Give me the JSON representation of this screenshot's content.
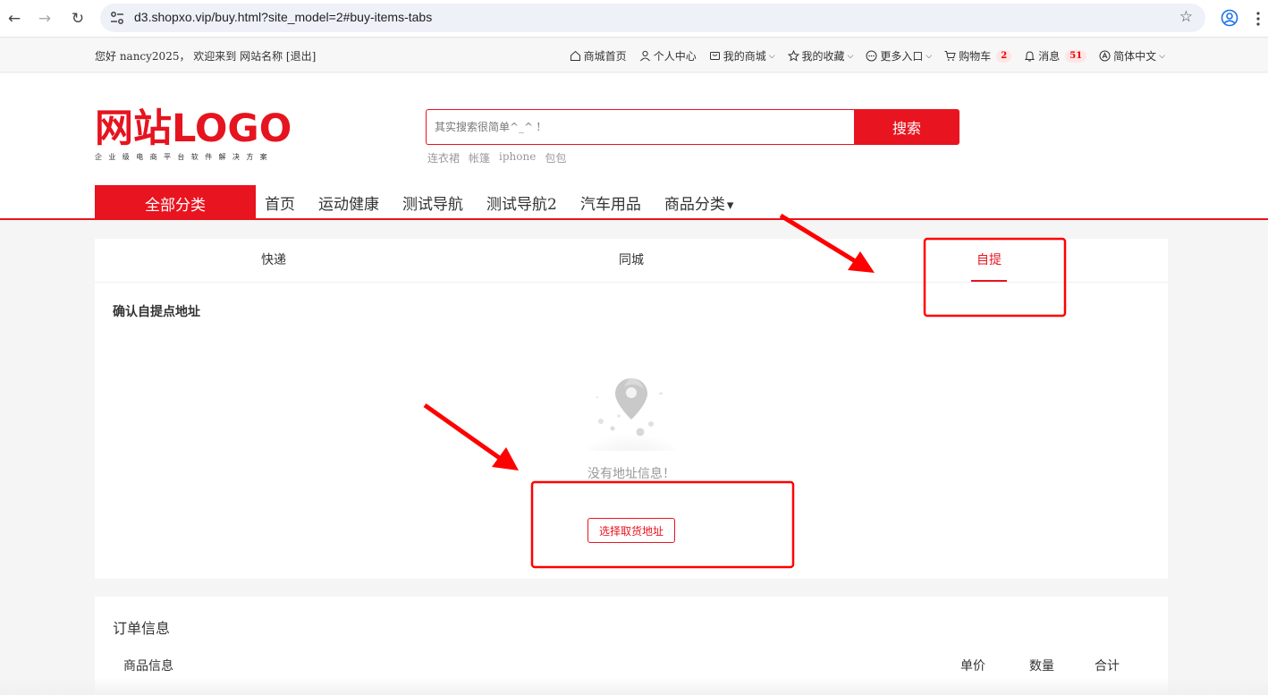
{
  "browser": {
    "url": "d3.shopxo.vip/buy.html?site_model=2#buy-items-tabs",
    "back_icon": "←",
    "forward_icon": "→",
    "reload_icon": "↻",
    "star_icon": "☆"
  },
  "topbar": {
    "welcome": "您好 nancy2025， 欢迎来到 网站名称 [退出]",
    "links": {
      "home": "商城首页",
      "user_center": "个人中心",
      "my_mall": "我的商城",
      "favorites": "我的收藏",
      "more": "更多入口",
      "cart": "购物车",
      "cart_count": "2",
      "messages": "消息",
      "message_count": "51",
      "language": "简体中文"
    },
    "caret": "⌵"
  },
  "header": {
    "logo_main": "网站LOGO",
    "logo_sub": "企业级电商平台软件解决方案",
    "search_placeholder": "其实搜索很简单^_^ !",
    "search_button": "搜索",
    "hot_words": [
      "连衣裙",
      "帐篷",
      "iphone",
      "包包"
    ]
  },
  "nav": {
    "all_categories": "全部分类",
    "items": [
      "首页",
      "运动健康",
      "测试导航",
      "测试导航2",
      "汽车用品",
      "商品分类"
    ],
    "dropdown_caret": "▾"
  },
  "delivery": {
    "tabs": [
      "快递",
      "同城",
      "自提"
    ],
    "active_tab": "自提",
    "confirm_title": "确认自提点地址",
    "empty_text": "没有地址信息！",
    "pick_button": "选择取货地址"
  },
  "order": {
    "title": "订单信息",
    "columns": [
      "商品信息",
      "单价",
      "数量",
      "合计"
    ]
  },
  "colors": {
    "brand_red": "#e8141f",
    "annotation_red": "#ff0000"
  }
}
